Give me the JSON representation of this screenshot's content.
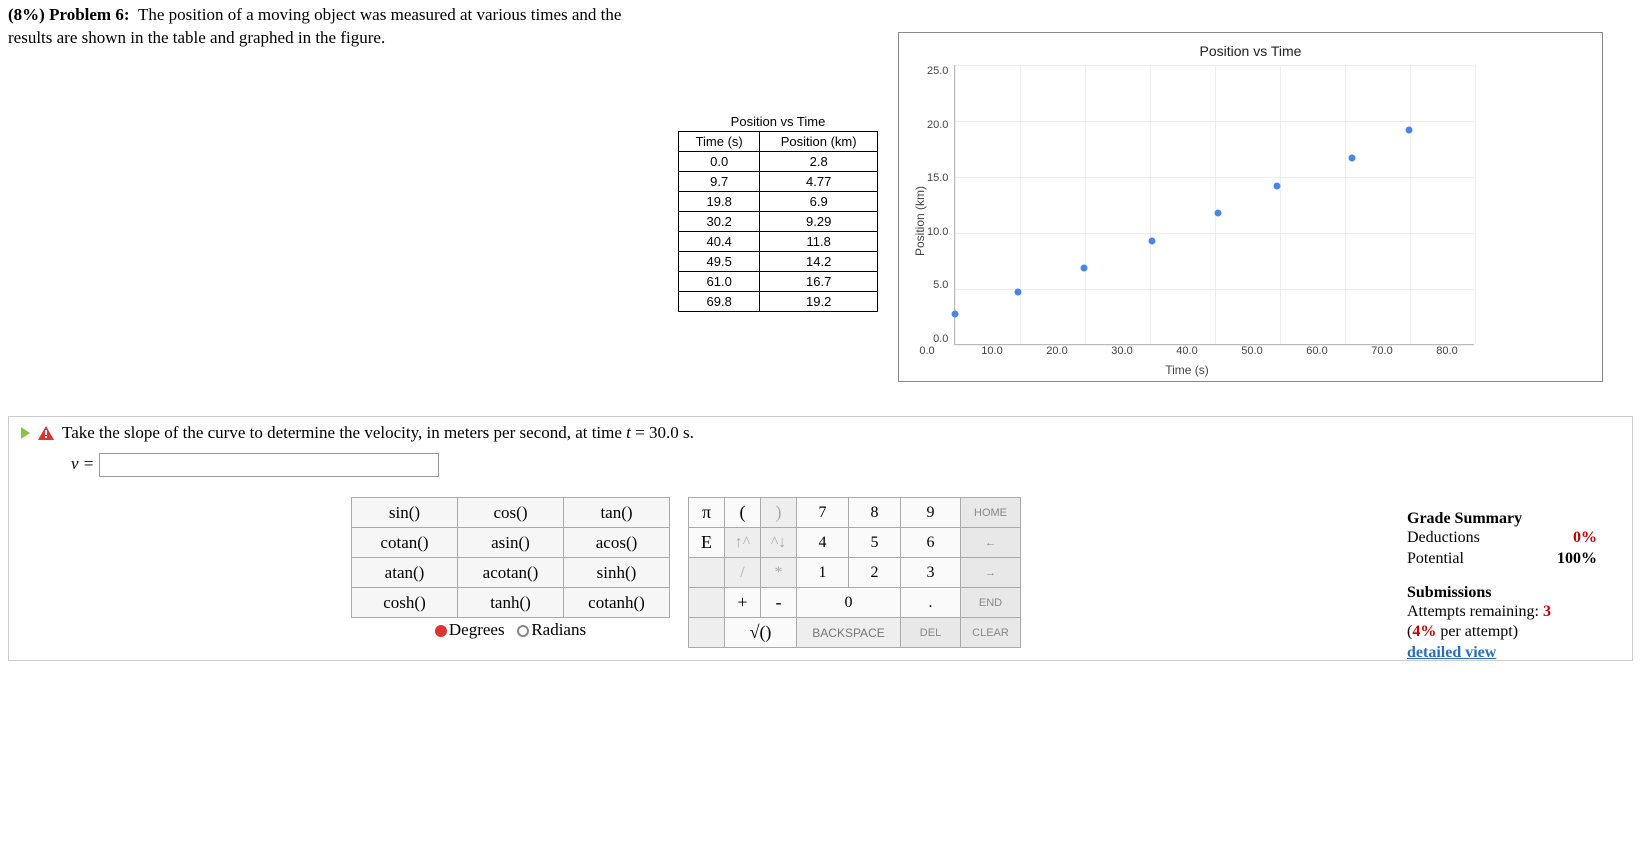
{
  "problem": {
    "weight": "(8%)",
    "label": "Problem 6:",
    "text": "The position of a moving object was measured at various times and the results are shown in the table and graphed in the figure."
  },
  "data_table": {
    "caption": "Position vs Time",
    "col1": "Time (s)",
    "col2": "Position (km)",
    "rows": [
      {
        "t": "0.0",
        "x": "2.8"
      },
      {
        "t": "9.7",
        "x": "4.77"
      },
      {
        "t": "19.8",
        "x": "6.9"
      },
      {
        "t": "30.2",
        "x": "9.29"
      },
      {
        "t": "40.4",
        "x": "11.8"
      },
      {
        "t": "49.5",
        "x": "14.2"
      },
      {
        "t": "61.0",
        "x": "16.7"
      },
      {
        "t": "69.8",
        "x": "19.2"
      }
    ]
  },
  "chart_data": {
    "type": "scatter",
    "title": "Position vs Time",
    "xlabel": "Time (s)",
    "ylabel": "Position (km)",
    "xlim": [
      0,
      80
    ],
    "ylim": [
      0,
      25
    ],
    "xticks": [
      "0.0",
      "10.0",
      "20.0",
      "30.0",
      "40.0",
      "50.0",
      "60.0",
      "70.0",
      "80.0"
    ],
    "yticks": [
      "25.0",
      "20.0",
      "15.0",
      "10.0",
      "5.0",
      "0.0"
    ],
    "x": [
      0.0,
      9.7,
      19.8,
      30.2,
      40.4,
      49.5,
      61.0,
      69.8
    ],
    "y": [
      2.8,
      4.77,
      6.9,
      9.29,
      11.8,
      14.2,
      16.7,
      19.2
    ]
  },
  "part": {
    "prompt_pre": "Take the slope of the curve to determine the velocity, in meters per second, at time ",
    "var_t": "t",
    "prompt_post": " = 30.0 s.",
    "answer_label": "v =",
    "answer_value": ""
  },
  "funckeys": {
    "r1": [
      "sin()",
      "cos()",
      "tan()"
    ],
    "r2": [
      "cotan()",
      "asin()",
      "acos()"
    ],
    "r3": [
      "atan()",
      "acotan()",
      "sinh()"
    ],
    "r4": [
      "cosh()",
      "tanh()",
      "cotanh()"
    ],
    "deg": "Degrees",
    "rad": "Radians"
  },
  "numkeys": {
    "pi": "π",
    "lp": "(",
    "rp": ")",
    "n7": "7",
    "n8": "8",
    "n9": "9",
    "home": "HOME",
    "E": "E",
    "up": "↑^",
    "dn": "^↓",
    "n4": "4",
    "n5": "5",
    "n6": "6",
    "back_arrow": "←",
    "slash": "/",
    "star": "*",
    "n1": "1",
    "n2": "2",
    "n3": "3",
    "fwd_arrow": "→",
    "plus": "+",
    "minus": "-",
    "n0": "0",
    "dot": ".",
    "end": "END",
    "sqrt": "√()",
    "bksp": "BACKSPACE",
    "del": "DEL",
    "clear": "CLEAR"
  },
  "summary": {
    "title1": "Grade Summary",
    "ded_label": "Deductions",
    "ded_val": "0%",
    "pot_label": "Potential",
    "pot_val": "100%",
    "title2": "Submissions",
    "att_label": "Attempts remaining: ",
    "att_val": "3",
    "per_label_pre": "(",
    "per_val": "4%",
    "per_label_post": " per attempt)",
    "link": "detailed view"
  }
}
